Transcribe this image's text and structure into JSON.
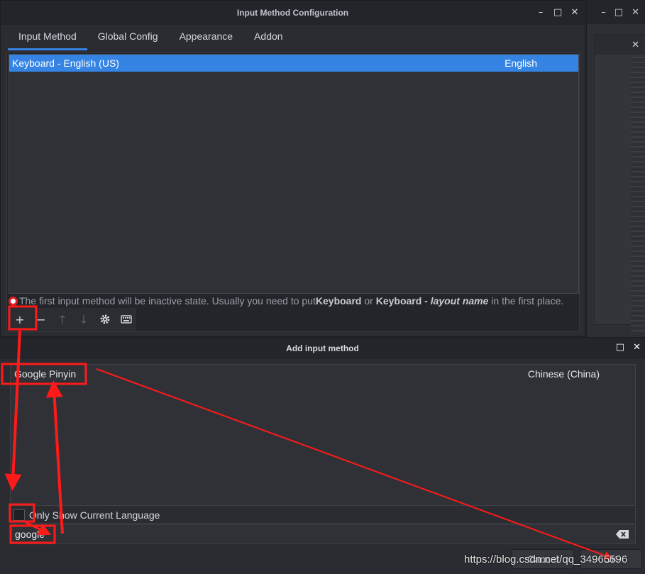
{
  "main_window": {
    "title": "Input Method Configuration",
    "controls": {
      "minimize": "–",
      "maximize": "□",
      "close": "✕"
    },
    "tabs": [
      {
        "label": "Input Method",
        "active": true
      },
      {
        "label": "Global Config",
        "active": false
      },
      {
        "label": "Appearance",
        "active": false
      },
      {
        "label": "Addon",
        "active": false
      }
    ],
    "input_methods": [
      {
        "name": "Keyboard - English (US)",
        "language": "English",
        "selected": true
      }
    ],
    "info": {
      "icon": "info-icon",
      "text_1": "The first input method will be inactive state. Usually you need to put ",
      "bold_1": "Keyboard",
      "text_2": " or ",
      "bold_2": "Keyboard - ",
      "bold_italic": "layout name",
      "text_3": " in the first place."
    },
    "toolbar": {
      "add": "+",
      "remove": "−",
      "move_up": "↑",
      "move_down": "↓"
    }
  },
  "background_window": {
    "controls": {
      "minimize": "–",
      "maximize": "□",
      "close": "✕"
    },
    "inner_close": "✕"
  },
  "add_dialog": {
    "title": "Add input method",
    "controls": {
      "maximize": "□",
      "close": "✕"
    },
    "results": [
      {
        "name": "Google Pinyin",
        "language": "Chinese (China)"
      }
    ],
    "only_current_language_label": "Only Show Current Language",
    "only_current_language_checked": false,
    "search_value": "google",
    "cancel_label": "Cancel",
    "ok_label": "OK"
  },
  "watermark": "https://blog.csdn.net/qq_34965596",
  "colors": {
    "accent": "#3584e4",
    "annotation": "#ff1a1a"
  }
}
